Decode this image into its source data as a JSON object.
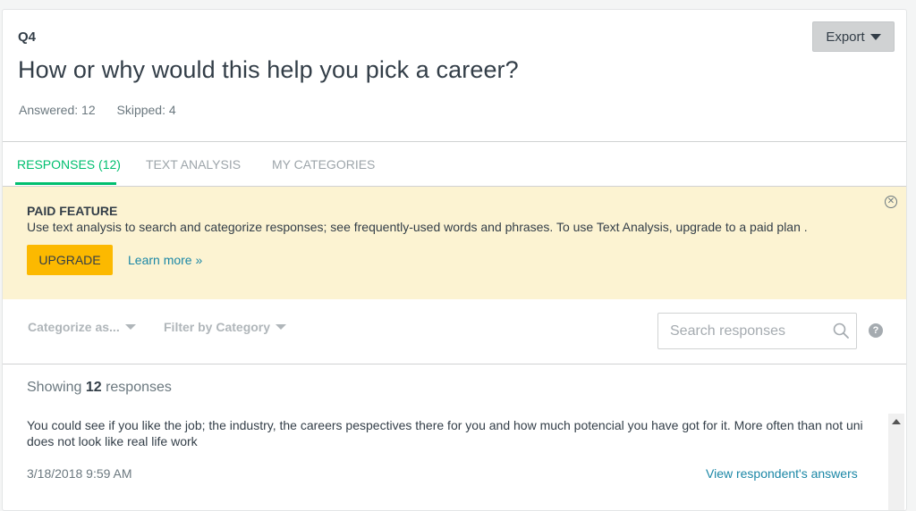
{
  "question": {
    "number": "Q4",
    "title": "How or why would this help you pick a career?",
    "answered": "Answered: 12",
    "skipped": "Skipped: 4"
  },
  "export_label": "Export",
  "tabs": [
    {
      "label": "RESPONSES (12)",
      "active": true
    },
    {
      "label": "TEXT ANALYSIS",
      "active": false
    },
    {
      "label": "MY CATEGORIES",
      "active": false
    }
  ],
  "banner": {
    "title": "PAID FEATURE",
    "text": "Use text analysis to search and categorize responses; see frequently-used words and phrases. To use Text Analysis, upgrade to a paid plan .",
    "upgrade_label": "UPGRADE",
    "learn_more": "Learn more »"
  },
  "toolbar": {
    "categorize_label": "Categorize as...",
    "filter_label": "Filter by Category",
    "search_placeholder": "Search responses",
    "help_symbol": "?"
  },
  "showing": {
    "prefix": "Showing",
    "count": "12",
    "suffix": "responses"
  },
  "responses": [
    {
      "text": "You could see if you like the job; the industry, the careers pespectives there for you and how much potencial you have got for it. More often than not uni does not look like real life work",
      "date": "3/18/2018 9:59 AM",
      "link": "View respondent's answers"
    }
  ],
  "colors": {
    "accent_green": "#00bf6f",
    "upgrade_yellow": "#fcb900",
    "banner_bg": "#fcf3d2",
    "link_blue": "#1b87a6"
  },
  "icons": {
    "export_caret": "chevron-down-icon",
    "close": "close-circle-icon",
    "search": "search-icon",
    "help": "help-icon",
    "scroll_up": "scroll-up-arrow-icon"
  }
}
